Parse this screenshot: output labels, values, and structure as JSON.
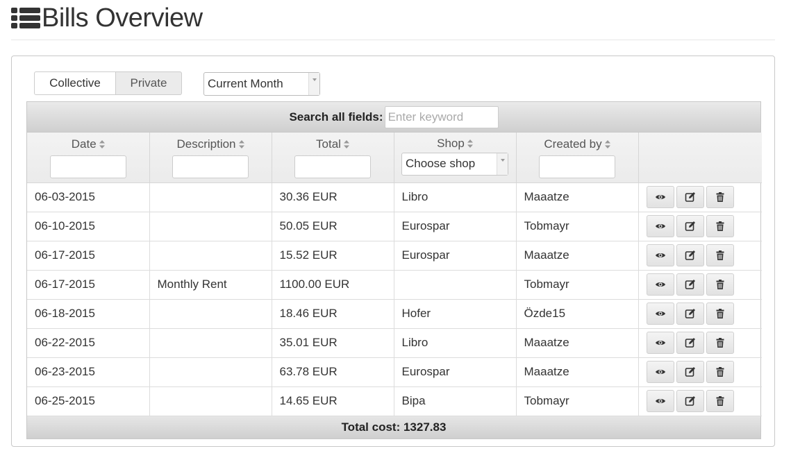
{
  "header": {
    "title": "Bills Overview"
  },
  "filters": {
    "toggle": [
      "Collective",
      "Private"
    ],
    "period": "Current Month"
  },
  "search": {
    "label": "Search all fields:",
    "placeholder": "Enter keyword"
  },
  "columns": {
    "date": "Date",
    "description": "Description",
    "total": "Total",
    "shop": "Shop",
    "shop_placeholder": "Choose shop",
    "created_by": "Created by"
  },
  "rows": [
    {
      "date": "06-03-2015",
      "description": "",
      "total": "30.36 EUR",
      "shop": "Libro",
      "created_by": "Maaatze"
    },
    {
      "date": "06-10-2015",
      "description": "",
      "total": "50.05 EUR",
      "shop": "Eurospar",
      "created_by": "Tobmayr"
    },
    {
      "date": "06-17-2015",
      "description": "",
      "total": "15.52 EUR",
      "shop": "Eurospar",
      "created_by": "Maaatze"
    },
    {
      "date": "06-17-2015",
      "description": "Monthly Rent",
      "total": "1100.00 EUR",
      "shop": "",
      "created_by": "Tobmayr"
    },
    {
      "date": "06-18-2015",
      "description": "",
      "total": "18.46 EUR",
      "shop": "Hofer",
      "created_by": "Özde15"
    },
    {
      "date": "06-22-2015",
      "description": "",
      "total": "35.01 EUR",
      "shop": "Libro",
      "created_by": "Maaatze"
    },
    {
      "date": "06-23-2015",
      "description": "",
      "total": "63.78 EUR",
      "shop": "Eurospar",
      "created_by": "Maaatze"
    },
    {
      "date": "06-25-2015",
      "description": "",
      "total": "14.65 EUR",
      "shop": "Bipa",
      "created_by": "Tobmayr"
    }
  ],
  "row_actions": [
    "eye-icon",
    "edit-icon",
    "trash-icon"
  ],
  "footer": {
    "total": "Total cost: 1327.83"
  }
}
